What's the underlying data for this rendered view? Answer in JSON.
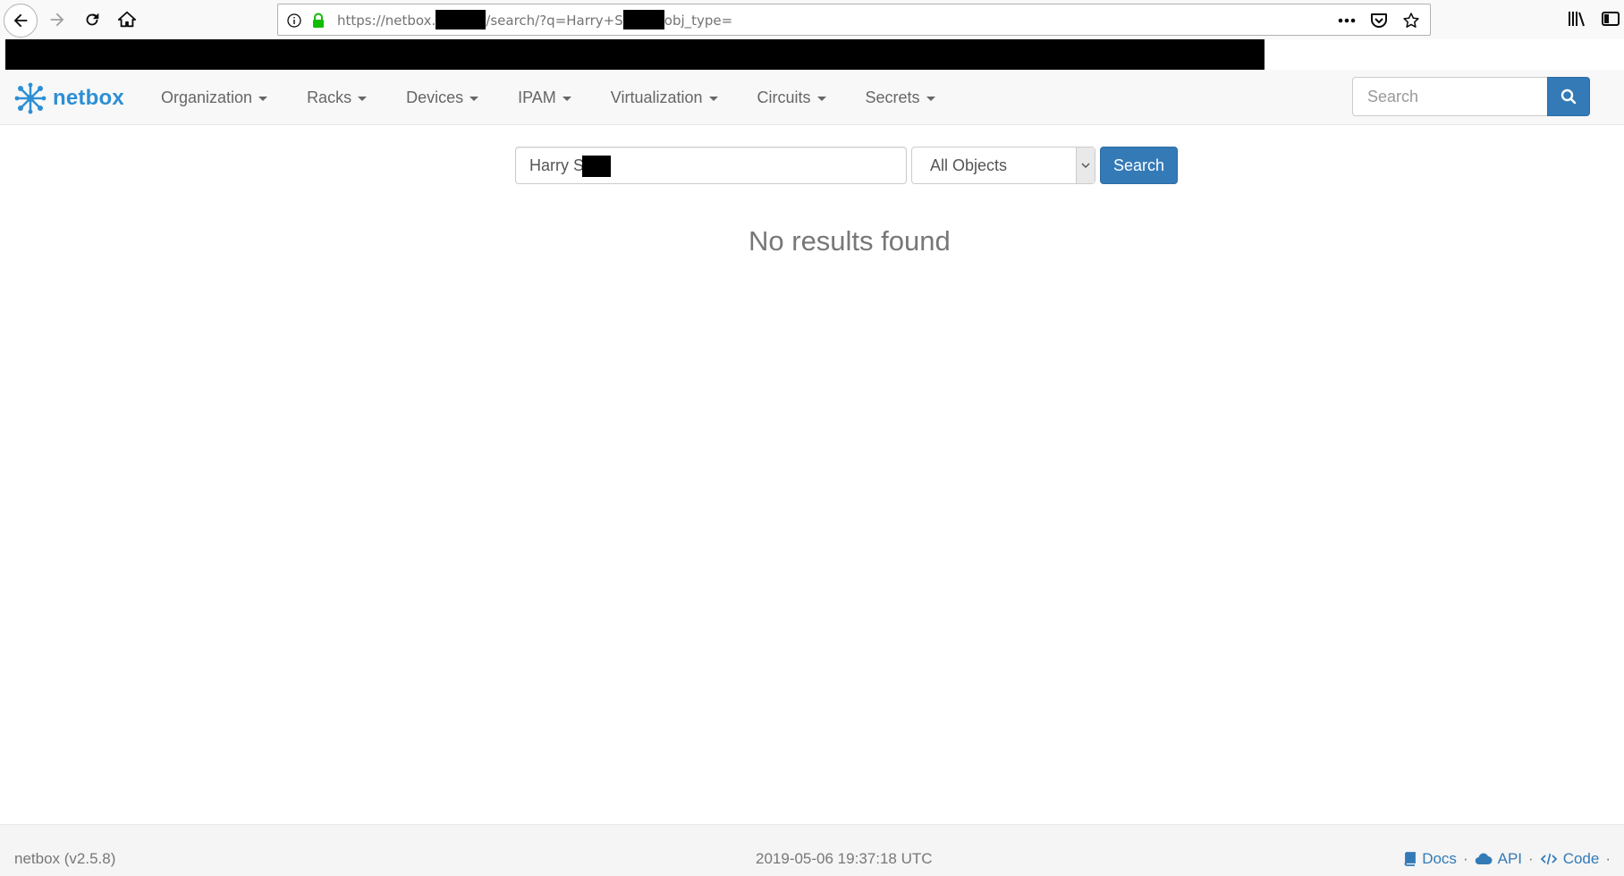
{
  "browser": {
    "url_prefix": "https://netbox.",
    "url_middle": "/search/?q=Harry+S",
    "url_suffix": "obj_type="
  },
  "navbar": {
    "brand": "netbox",
    "menu": [
      {
        "label": "Organization"
      },
      {
        "label": "Racks"
      },
      {
        "label": "Devices"
      },
      {
        "label": "IPAM"
      },
      {
        "label": "Virtualization"
      },
      {
        "label": "Circuits"
      },
      {
        "label": "Secrets"
      }
    ],
    "search_placeholder": "Search"
  },
  "search_form": {
    "query_value": "Harry S",
    "object_type_selected": "All Objects",
    "submit_label": "Search"
  },
  "results": {
    "message": "No results found"
  },
  "footer": {
    "version": "netbox (v2.5.8)",
    "timestamp": "2019-05-06 19:37:18 UTC",
    "links": [
      {
        "label": "Docs",
        "icon": "book-icon"
      },
      {
        "label": "API",
        "icon": "cloud-icon"
      },
      {
        "label": "Code",
        "icon": "code-icon"
      }
    ]
  },
  "colors": {
    "brand": "#2d8fd5",
    "primary": "#337ab7",
    "navbar_bg": "#f8f8f8",
    "footer_bg": "#f5f5f5"
  }
}
